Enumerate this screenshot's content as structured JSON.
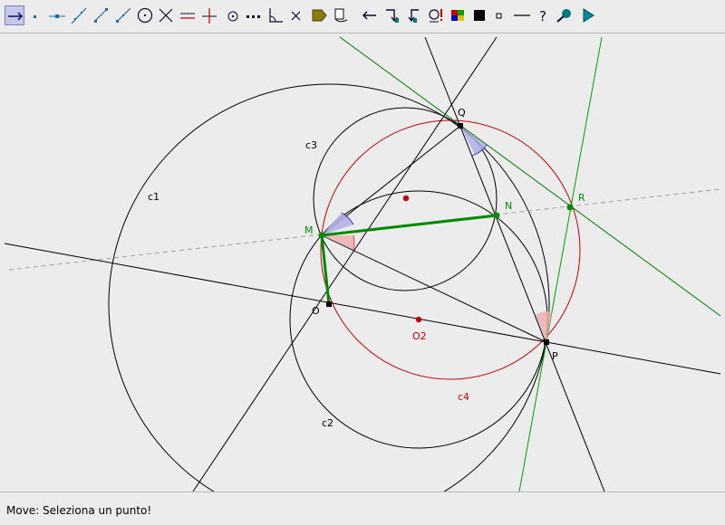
{
  "toolbar": {
    "tools": [
      {
        "id": "move",
        "active": true
      },
      {
        "id": "new-point"
      },
      {
        "id": "point-on-object"
      },
      {
        "id": "line-through-two-points"
      },
      {
        "id": "segment-between-two-points"
      },
      {
        "id": "ray-through-two-points"
      },
      {
        "id": "circle-center-point"
      },
      {
        "id": "intersect-two-objects"
      },
      {
        "id": "parallel-line"
      },
      {
        "id": "perpendicular-line"
      },
      {
        "id": "midpoint"
      },
      {
        "id": "polygon"
      },
      {
        "id": "angle"
      },
      {
        "id": "delete-object"
      },
      {
        "id": "show-hide-label"
      },
      {
        "id": "show-hide-object"
      },
      {
        "id": "undo"
      },
      {
        "id": "reflect-about-line"
      },
      {
        "id": "rotate-around-point"
      },
      {
        "id": "relation-check"
      },
      {
        "id": "color-palette"
      },
      {
        "id": "fill-square"
      },
      {
        "id": "point-size"
      },
      {
        "id": "line-style"
      },
      {
        "id": "help"
      },
      {
        "id": "zoom-tool"
      },
      {
        "id": "run-macro"
      }
    ]
  },
  "canvas": {
    "labels": {
      "c1": "c1",
      "c2": "c2",
      "c3": "c3",
      "c4": "c4",
      "Q": "Q",
      "M": "M",
      "N": "N",
      "R": "R",
      "O": "O",
      "O2": "O2",
      "P": "P"
    },
    "colors": {
      "black": "#000000",
      "red": "#c00000",
      "green": "#00a000",
      "dark_green": "#007a00",
      "gray_dash": "#a0a0a0",
      "angle_blue": "#3030c0",
      "angle_red": "#e07070"
    }
  },
  "status": {
    "text": "Move: Seleziona un punto!"
  }
}
